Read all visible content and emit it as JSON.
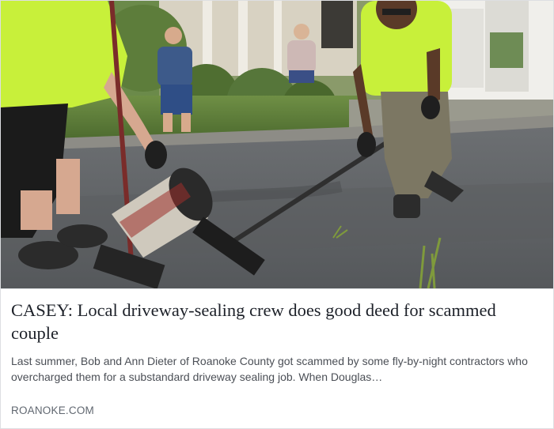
{
  "link_preview": {
    "headline": "CASEY: Local driveway-sealing crew does good deed for scammed couple",
    "description": "Last summer, Bob and Ann Dieter of Roanoke County got scammed by some fly-by-night contractors who overcharged them for a substandard driveway sealing job. When Douglas…",
    "source": "ROANOKE.COM"
  },
  "colors": {
    "headline": "#1d2129",
    "description": "#4b4f56",
    "source": "#606770",
    "border": "#dddfe2",
    "safety_vest": "#c8f03a"
  }
}
